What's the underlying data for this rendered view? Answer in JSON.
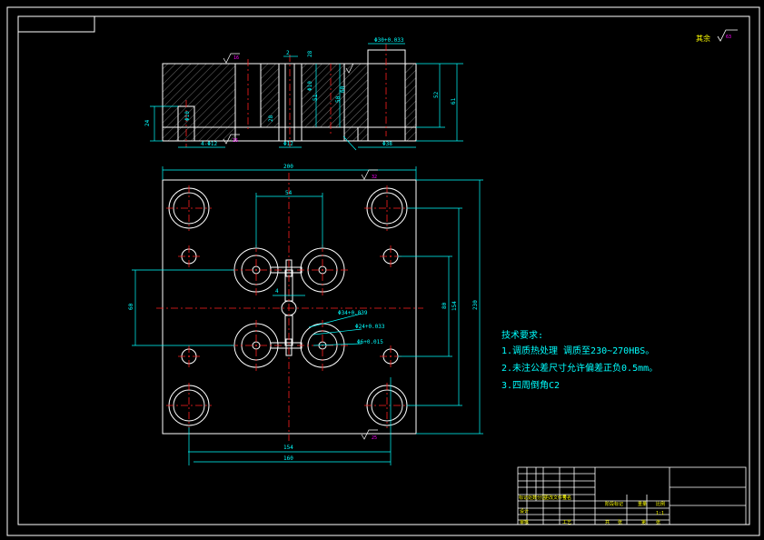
{
  "colors": {
    "background": "#000000",
    "frame": "#ffffff",
    "outline": "#ffffff",
    "dimension": "#00ffff",
    "centerline": "#ff2020",
    "hatch": "#bdbdbd",
    "note_text": "#00ffff",
    "roughness_value": "#ff00ff",
    "title_text": "#ffff00"
  },
  "section_view": {
    "dims": {
      "overall_height": "61",
      "bore_depth": "52",
      "bore_dia": "Φ30+0.033",
      "cb_dia": "Φ38",
      "left_height": "24",
      "left_pin": "4-Φ12",
      "slot_width": "Φ12",
      "top_gap": "2",
      "mid_a": "51",
      "mid_b": "Φ10",
      "left_small": "Φ10",
      "side_a": "50",
      "side_b": "60",
      "inner_mark": "28",
      "inner_mark2": "28"
    },
    "roughness": [
      "16",
      "16"
    ]
  },
  "plan_view": {
    "dims": {
      "width": "200",
      "height": "230",
      "hole_spacing_x": "54",
      "hole_spacing_y": "60",
      "pin_spacing_y": "80",
      "pin_spacing_y_outer": "154",
      "gap": "4",
      "runner_1": "Φ34+0.039",
      "runner_2": "Φ24+0.033",
      "runner_3": "Φ6+0.015",
      "bottom_inner": "154",
      "bottom_outer": "160"
    },
    "roughness": [
      "32",
      "25"
    ]
  },
  "general_roughness": {
    "label": "其余",
    "value": "63"
  },
  "tech_notes": {
    "heading": "技术要求:",
    "items": [
      "1.调质热处理 调质至230~270HBS。",
      "2.未注公差尺寸允许偏差正负0.5mm。",
      "3.四周倒角C2"
    ]
  },
  "title_block": {
    "cells": [
      "标记",
      "处数",
      "分区",
      "更改文件号",
      "签名",
      "设计",
      "审核",
      "工艺",
      "阶段标记",
      "重量",
      "比例",
      "1:1",
      "共",
      "张",
      "第",
      "张"
    ]
  }
}
